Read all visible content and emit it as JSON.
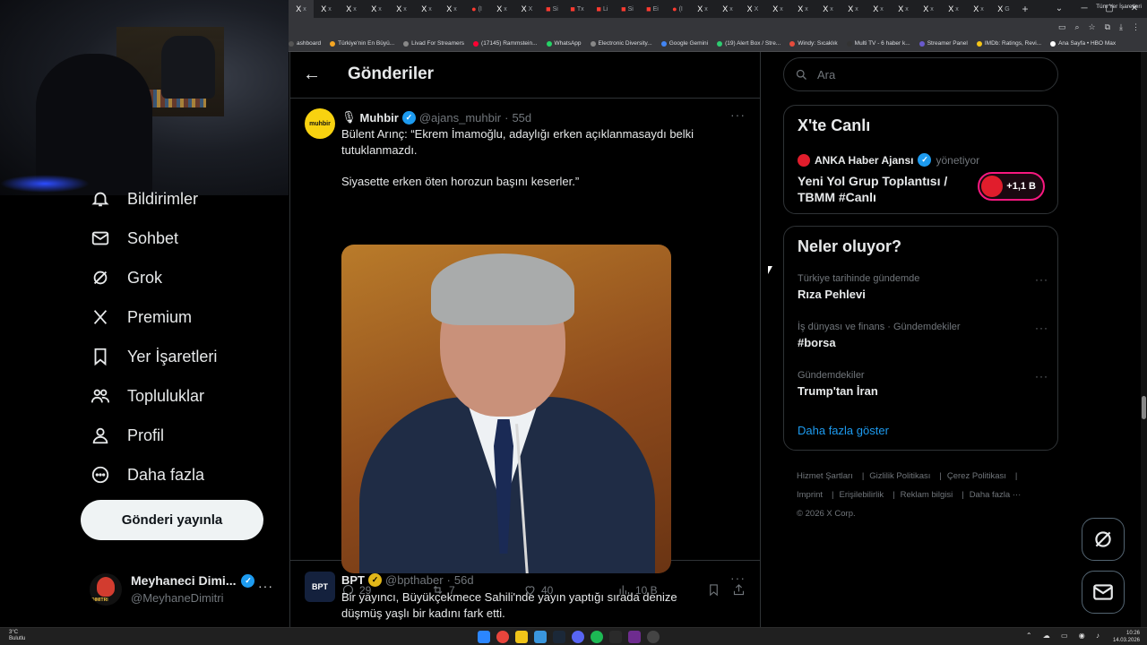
{
  "browser": {
    "tabs": [
      {
        "icon": "X",
        "label": "x"
      },
      {
        "icon": "X",
        "label": "x"
      },
      {
        "icon": "X",
        "label": "x"
      },
      {
        "icon": "X",
        "label": "x"
      },
      {
        "icon": "X",
        "label": "x"
      },
      {
        "icon": "X",
        "label": "x"
      },
      {
        "icon": "X",
        "label": "x"
      },
      {
        "icon": "●",
        "label": "(I"
      },
      {
        "icon": "X",
        "label": "x"
      },
      {
        "icon": "X",
        "label": "X"
      },
      {
        "icon": "■",
        "label": "Si"
      },
      {
        "icon": "■",
        "label": "Tx"
      },
      {
        "icon": "■",
        "label": "Li"
      },
      {
        "icon": "■",
        "label": "Si"
      },
      {
        "icon": "■",
        "label": "Ei"
      },
      {
        "icon": "●",
        "label": "(I"
      },
      {
        "icon": "X",
        "label": "x"
      },
      {
        "icon": "X",
        "label": "x"
      },
      {
        "icon": "X",
        "label": "X"
      },
      {
        "icon": "X",
        "label": "x"
      },
      {
        "icon": "X",
        "label": "x"
      },
      {
        "icon": "X",
        "label": "x"
      },
      {
        "icon": "X",
        "label": "x"
      },
      {
        "icon": "X",
        "label": "x"
      },
      {
        "icon": "X",
        "label": "x"
      },
      {
        "icon": "X",
        "label": "x"
      },
      {
        "icon": "X",
        "label": "x"
      },
      {
        "icon": "X",
        "label": "x"
      },
      {
        "icon": "X",
        "label": "G"
      }
    ],
    "bookmarks": [
      "ashboard",
      "Türkiye'nin En Büyü...",
      "Livad For Streamers",
      "(17145) Rammstein...",
      "WhatsApp",
      "Electronic Diversity...",
      "Google Gemini",
      "(19) Alert Box / Stre...",
      "Windy: Sıcaklık",
      "Multi TV - 6 haber k...",
      "Streamer Panel",
      "IMDb: Ratings, Revi...",
      "Ana Sayfa • HBO Max"
    ],
    "bookmarks_all": "Tüm Yer İşaretleri"
  },
  "nav": {
    "items": [
      {
        "label": "Bildirimler",
        "icon": "bell-icon"
      },
      {
        "label": "Sohbet",
        "icon": "mail-icon"
      },
      {
        "label": "Grok",
        "icon": "grok-icon"
      },
      {
        "label": "Premium",
        "icon": "x-logo-icon"
      },
      {
        "label": "Yer İşaretleri",
        "icon": "bookmark-icon"
      },
      {
        "label": "Topluluklar",
        "icon": "communities-icon"
      },
      {
        "label": "Profil",
        "icon": "person-icon"
      },
      {
        "label": "Daha fazla",
        "icon": "more-circle-icon"
      }
    ],
    "post_button": "Gönderi yayınla",
    "profile": {
      "name": "Meyhaneci Dimi...",
      "handle": "@MeyhaneDimitri"
    }
  },
  "center": {
    "title": "Gönderiler",
    "tweets": [
      {
        "avatar_text": "muhbir",
        "prefix_icon": "🎙",
        "name": "Muhbir",
        "handle": "@ajans_muhbir",
        "time": "55d",
        "lines": [
          "Bülent Arınç: “Ekrem İmamoğlu, adaylığı erken açıklanmasaydı belki tutuklanmazdı.",
          "Siyasette erken öten horozun başını keserler.”"
        ],
        "replies": "29",
        "reposts": "7",
        "likes": "40",
        "views": "10 B"
      },
      {
        "avatar_text": "BPT",
        "name": "BPT",
        "handle": "@bpthaber",
        "time": "56d",
        "lines": [
          "Bir yayıncı, Büyükçekmece Sahili'nde yayın yaptığı sırada denize düşmüş yaşlı bir kadını fark etti."
        ]
      }
    ]
  },
  "sidebar": {
    "search_placeholder": "Ara",
    "live": {
      "title": "X'te Canlı",
      "host": "ANKA Haber Ajansı",
      "host_role": "yönetiyor",
      "stream_title": "Yeni Yol Grup Toplantısı / TBMM #Canlı",
      "listeners": "+1,1 B"
    },
    "trends": {
      "title": "Neler oluyor?",
      "items": [
        {
          "meta": "Türkiye tarihinde gündemde",
          "name": "Rıza Pehlevi"
        },
        {
          "meta": "İş dünyası ve finans · Gündemdekiler",
          "name": "#borsa"
        },
        {
          "meta": "Gündemdekiler",
          "name": "Trump'tan İran"
        }
      ],
      "show_more": "Daha fazla göster"
    },
    "footer": {
      "links": [
        "Hizmet Şartları",
        "Gizlilik Politikası",
        "Çerez Politikası",
        "Imprint",
        "Erişilebilirlik",
        "Reklam bilgisi",
        "Daha fazla ···"
      ],
      "copyright": "© 2026 X Corp."
    }
  },
  "taskbar": {
    "weather_temp": "3°C",
    "weather_desc": "Bulutlu",
    "time": "10:26",
    "date": "14.03.2026"
  },
  "colors": {
    "accent": "#1d9bf0",
    "background": "#000000",
    "live_ring": "#f91880"
  }
}
